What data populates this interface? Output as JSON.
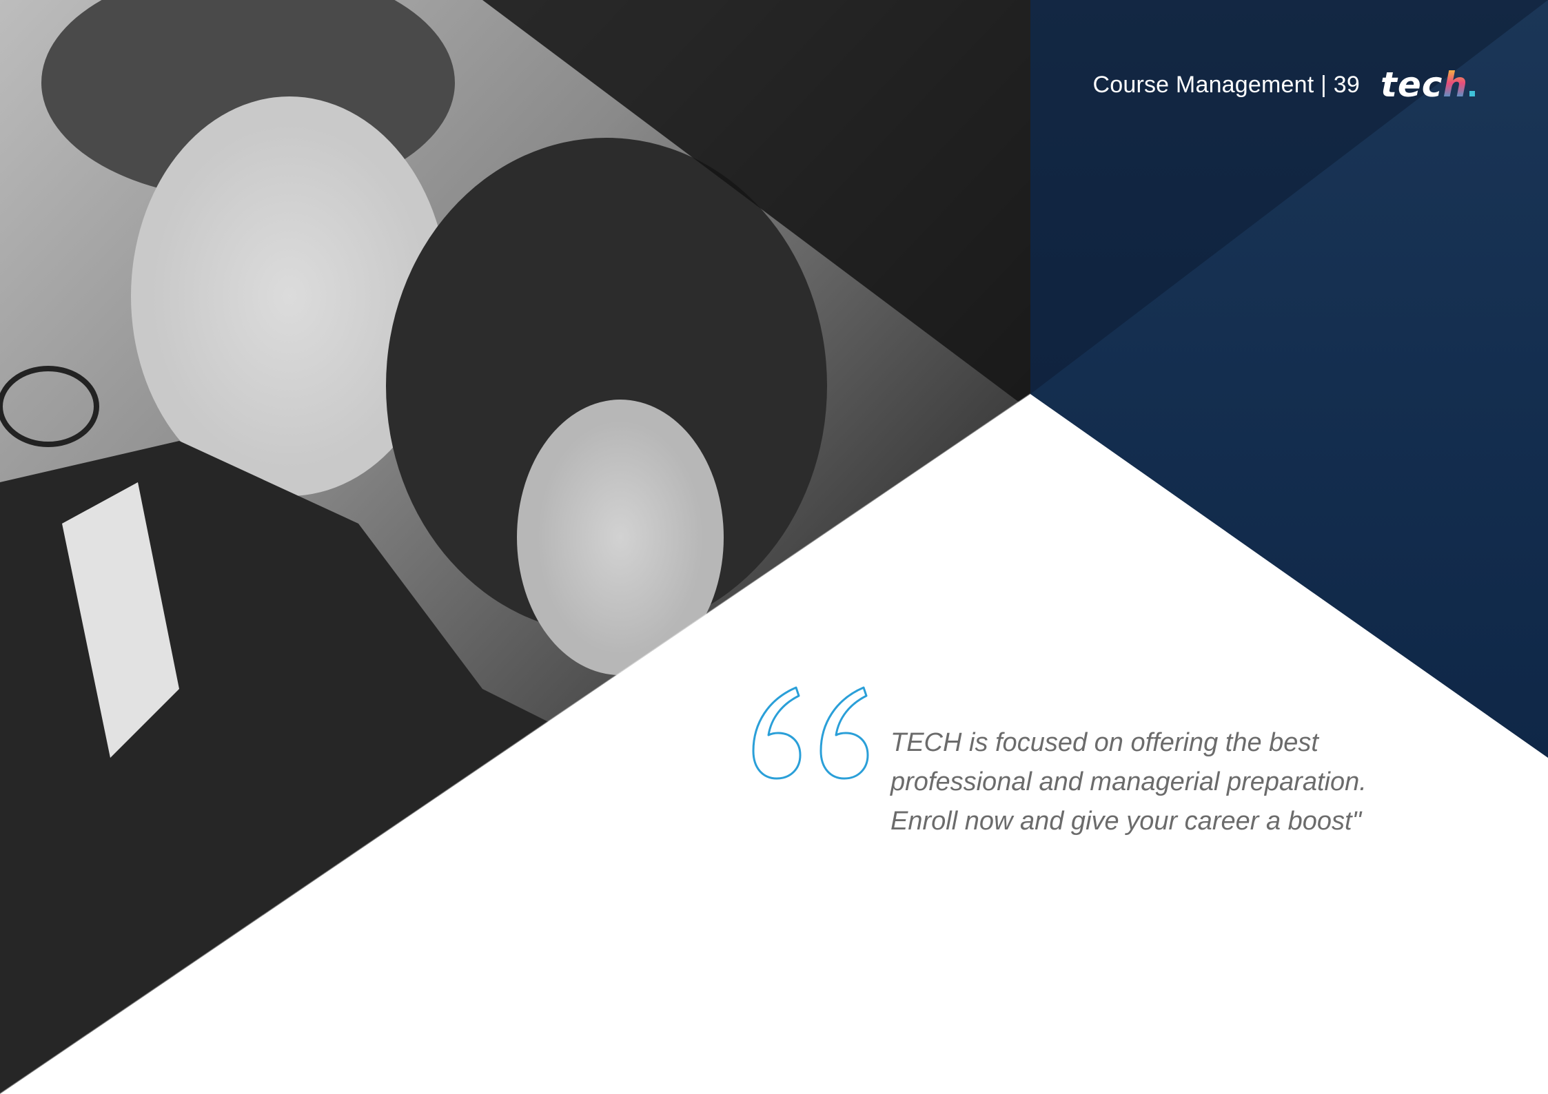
{
  "header": {
    "section_label": "Course Management | 39",
    "logo": {
      "text_main": "tec",
      "text_accent": "h"
    }
  },
  "quote": {
    "lines": [
      "TECH is focused on offering the best",
      "professional and managerial preparation.",
      "Enroll now and give your career a boost\""
    ]
  },
  "icons": {
    "quote": "quote-open-icon",
    "photo": "people-photo"
  },
  "colors": {
    "navy": "#14304f",
    "quote_accent": "#2a9fd8",
    "quote_text": "#6b6b6b"
  }
}
